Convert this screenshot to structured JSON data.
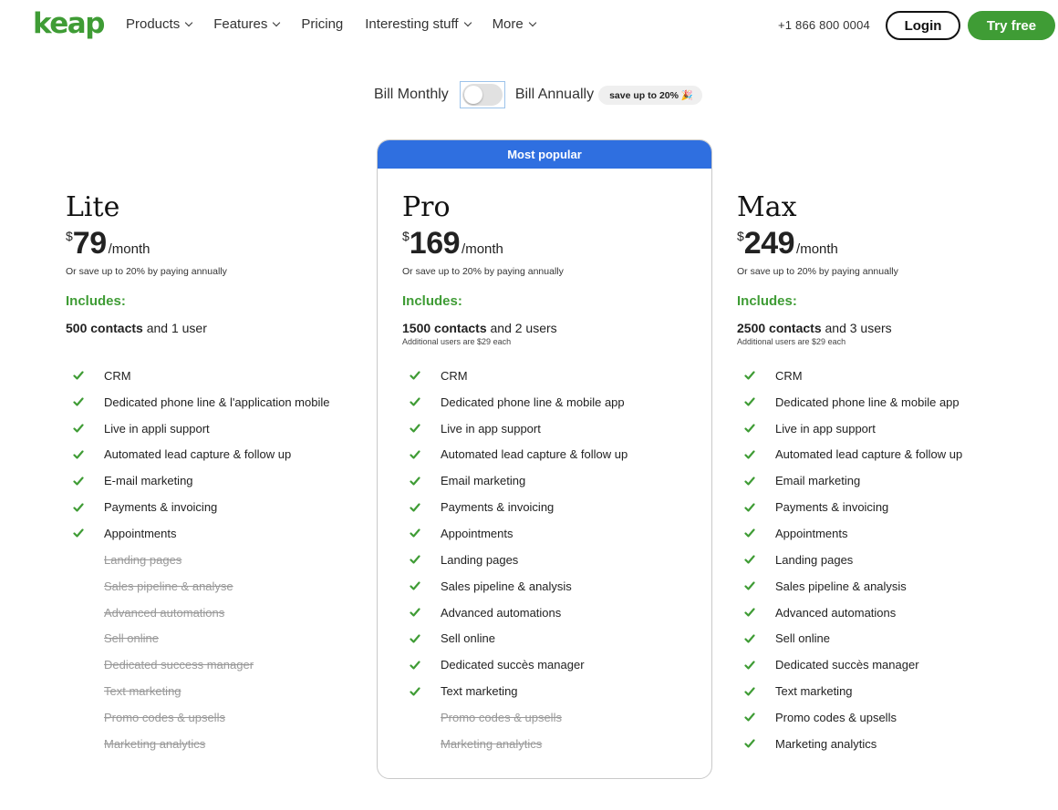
{
  "nav": {
    "logo": "keap",
    "links": [
      "Products",
      "Features",
      "Pricing",
      "Interesting stuff",
      "More"
    ],
    "phone": "+1 866 800 0004",
    "login": "Login",
    "try_free": "Try free"
  },
  "billing": {
    "monthly_label": "Bill Monthly",
    "annual_label": "Bill Annually",
    "save_badge": "save up to 20% 🎉",
    "annual_selected": false
  },
  "popular_label": "Most popular",
  "plans": [
    {
      "name": "Lite",
      "currency": "$",
      "price": "79",
      "period": "/month",
      "annual_note": "Or save up to 20% by paying annually",
      "includes": "Includes:",
      "contacts": "500 contacts",
      "users": " and 1 user",
      "extra_users": "",
      "features": [
        {
          "label": "CRM",
          "included": true
        },
        {
          "label": "Dedicated phone line & l'application mobile",
          "included": true
        },
        {
          "label": "Live in appli support",
          "included": true
        },
        {
          "label": "Automated lead capture & follow up",
          "included": true
        },
        {
          "label": "E-mail marketing",
          "included": true
        },
        {
          "label": "Payments & invoicing",
          "included": true
        },
        {
          "label": "Appointments",
          "included": true
        },
        {
          "label": "Landing pages",
          "included": false
        },
        {
          "label": "Sales pipeline & analyse",
          "included": false
        },
        {
          "label": "Advanced automations",
          "included": false
        },
        {
          "label": "Sell online",
          "included": false
        },
        {
          "label": "Dedicated success manager",
          "included": false
        },
        {
          "label": "Text marketing",
          "included": false
        },
        {
          "label": "Promo codes & upsells",
          "included": false
        },
        {
          "label": "Marketing analytics",
          "included": false
        }
      ]
    },
    {
      "name": "Pro",
      "currency": "$",
      "price": "169",
      "period": "/month",
      "annual_note": "Or save up to 20% by paying annually",
      "includes": "Includes:",
      "contacts": "1500 contacts",
      "users": " and 2 users",
      "extra_users": "Additional users are $29 each",
      "features": [
        {
          "label": "CRM",
          "included": true
        },
        {
          "label": "Dedicated phone line & mobile app",
          "included": true
        },
        {
          "label": "Live in app support",
          "included": true
        },
        {
          "label": "Automated lead capture & follow up",
          "included": true
        },
        {
          "label": "Email marketing",
          "included": true
        },
        {
          "label": "Payments & invoicing",
          "included": true
        },
        {
          "label": "Appointments",
          "included": true
        },
        {
          "label": "Landing pages",
          "included": true
        },
        {
          "label": "Sales pipeline & analysis",
          "included": true
        },
        {
          "label": "Advanced automations",
          "included": true
        },
        {
          "label": "Sell online",
          "included": true
        },
        {
          "label": "Dedicated succès manager",
          "included": true
        },
        {
          "label": "Text marketing",
          "included": true
        },
        {
          "label": "Promo codes & upsells",
          "included": false
        },
        {
          "label": "Marketing analytics",
          "included": false
        }
      ]
    },
    {
      "name": "Max",
      "currency": "$",
      "price": "249",
      "period": "/month",
      "annual_note": "Or save up to 20% by paying annually",
      "includes": "Includes:",
      "contacts": "2500 contacts",
      "users": " and 3 users",
      "extra_users": "Additional users are $29 each",
      "features": [
        {
          "label": "CRM",
          "included": true
        },
        {
          "label": "Dedicated phone line & mobile app",
          "included": true
        },
        {
          "label": "Live in app support",
          "included": true
        },
        {
          "label": "Automated lead capture & follow up",
          "included": true
        },
        {
          "label": "Email marketing",
          "included": true
        },
        {
          "label": "Payments & invoicing",
          "included": true
        },
        {
          "label": "Appointments",
          "included": true
        },
        {
          "label": "Landing pages",
          "included": true
        },
        {
          "label": "Sales pipeline & analysis",
          "included": true
        },
        {
          "label": "Advanced automations",
          "included": true
        },
        {
          "label": "Sell online",
          "included": true
        },
        {
          "label": "Dedicated succès manager",
          "included": true
        },
        {
          "label": "Text marketing",
          "included": true
        },
        {
          "label": "Promo codes & upsells",
          "included": true
        },
        {
          "label": "Marketing analytics",
          "included": true
        }
      ]
    }
  ],
  "colors": {
    "brand_green": "#3f9c35",
    "popular_blue": "#2f6fe0"
  }
}
